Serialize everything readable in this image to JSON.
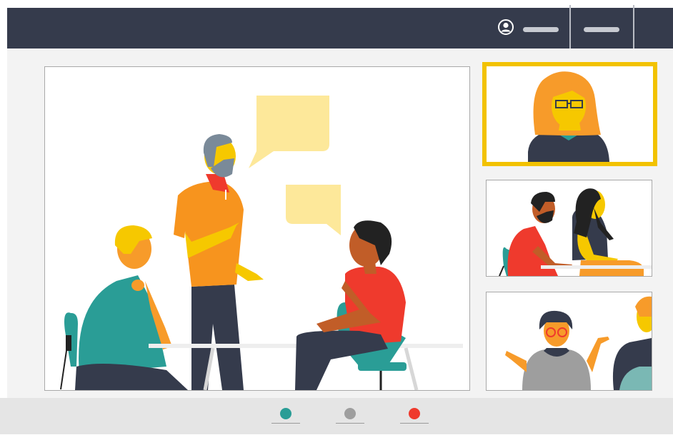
{
  "topbar": {
    "icons": [
      "user-account-icon"
    ],
    "menu_placeholders": 2
  },
  "colors": {
    "topbar": "#353b4c",
    "stage": "#f3f3f3",
    "active_speaker_border": "#f2c200",
    "bottombar": "#e5e5e5",
    "video_toggle": "#2a9d96",
    "audio_toggle": "#9e9e9e",
    "end_call": "#ef3a2d"
  },
  "tiles": {
    "main": "group-conversation",
    "participants": [
      "woman-with-glasses",
      "two-people-at-table",
      "person-shrugging"
    ]
  },
  "controls": [
    {
      "name": "video-toggle-button",
      "icon": "video-dot-icon"
    },
    {
      "name": "audio-toggle-button",
      "icon": "microphone-dot-icon"
    },
    {
      "name": "end-call-button",
      "icon": "end-call-dot-icon"
    }
  ]
}
